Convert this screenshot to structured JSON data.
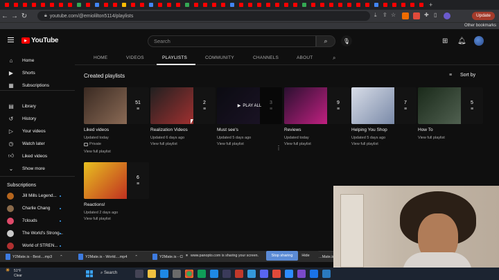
{
  "browser": {
    "url": "youtube.com/@emiolilton5114/playlists",
    "update_label": "Update",
    "other_bookmarks": "Other bookmarks"
  },
  "tab_colors": [
    "#ff0000",
    "#ff0000",
    "#ff0000",
    "#ff0000",
    "#ff0000",
    "#ff0000",
    "#ff0000",
    "#ff0000",
    "#34a853",
    "#ff0000",
    "#4285f4",
    "#ff0000",
    "#ff0000",
    "#fbbc04",
    "#ff0000",
    "#ff0000",
    "#4285f4",
    "#ff0000",
    "#ff0000",
    "#ff0000",
    "#34a853",
    "#ff0000",
    "#ff0000",
    "#ff0000",
    "#ff0000",
    "#4285f4",
    "#ff0000",
    "#ff0000",
    "#ff0000",
    "#ff0000",
    "#ff0000",
    "#ff0000",
    "#ff0000",
    "#34a853",
    "#ff0000",
    "#ff0000",
    "#ff0000",
    "#ff0000",
    "#ff0000",
    "#ff0000",
    "#ff0000",
    "#4285f4",
    "#ff0000",
    "#ff0000",
    "#ff0000",
    "#ff0000",
    "#ff0000"
  ],
  "header": {
    "logo_text": "YouTube",
    "search_placeholder": "Search"
  },
  "sidebar": {
    "items": [
      {
        "label": "Home",
        "icon": "home-icon"
      },
      {
        "label": "Shorts",
        "icon": "shorts-icon"
      },
      {
        "label": "Subscriptions",
        "icon": "subscriptions-icon"
      },
      {
        "label": "Library",
        "icon": "library-icon"
      },
      {
        "label": "History",
        "icon": "history-icon"
      },
      {
        "label": "Your videos",
        "icon": "your-videos-icon"
      },
      {
        "label": "Watch later",
        "icon": "watch-later-icon"
      },
      {
        "label": "Liked videos",
        "icon": "liked-videos-icon"
      },
      {
        "label": "Show more",
        "icon": "chevron-down-icon"
      }
    ],
    "subscriptions_heading": "Subscriptions",
    "subscriptions": [
      {
        "label": "Jill Mills Legend...",
        "color": "#b5651d"
      },
      {
        "label": "Charlie Chang",
        "color": "#8a6a4a"
      },
      {
        "label": "7clouds",
        "color": "#e04a6a"
      },
      {
        "label": "The World's Strong...",
        "color": "#c9c9c9"
      },
      {
        "label": "World of STREN...",
        "color": "#b03030"
      }
    ]
  },
  "channel_tabs": [
    {
      "label": "HOME"
    },
    {
      "label": "VIDEOS"
    },
    {
      "label": "PLAYLISTS"
    },
    {
      "label": "COMMUNITY"
    },
    {
      "label": "CHANNELS"
    },
    {
      "label": "ABOUT"
    }
  ],
  "section": {
    "heading": "Created playlists",
    "sort_label": "Sort by"
  },
  "playlists": [
    {
      "title": "Liked videos",
      "count": "51",
      "updated": "Updated today",
      "privacy": "Private",
      "link": "View full playlist",
      "c1": "#3a2a22",
      "c2": "#8a6a55"
    },
    {
      "title": "Realization Videos",
      "count": "2",
      "updated": "Updated 6 days ago",
      "link": "View full playlist",
      "c1": "#202020",
      "c2": "#a03030"
    },
    {
      "title": "Must see's",
      "count": "3",
      "updated": "Updated 5 days ago",
      "link": "View full playlist",
      "play_all": "PLAY ALL",
      "c1": "#1a1a28",
      "c2": "#3a2a50"
    },
    {
      "title": "Reviews",
      "count": "9",
      "updated": "Updated today",
      "link": "View full playlist",
      "c1": "#2a1030",
      "c2": "#c02080"
    },
    {
      "title": "Helping You Shop",
      "count": "7",
      "updated": "Updated 5 days ago",
      "link": "View full playlist",
      "c1": "#d8dde8",
      "c2": "#7a8aa8"
    },
    {
      "title": "How To",
      "count": "5",
      "updated": "",
      "link": "View full playlist",
      "c1": "#1a2a1a",
      "c2": "#506050"
    },
    {
      "title": "Reactions!",
      "count": "6",
      "updated": "Updated 2 days ago",
      "link": "View full playlist",
      "c1": "#e8c020",
      "c2": "#c03020"
    }
  ],
  "screen_share": {
    "message": "www.panopto.com is sharing your screen.",
    "stop_label": "Stop sharing",
    "hide_label": "Hide"
  },
  "downloads": [
    {
      "label": "Y2Mate.is - Best....mp3"
    },
    {
      "label": "Y2Mate.is - World....mp4"
    },
    {
      "label": "Y2Mate.is - Cl..."
    },
    {
      "label": "...Mate.is - Th..."
    }
  ],
  "taskbar": {
    "temperature": "51°F",
    "condition": "Clear",
    "search_label": "Search"
  }
}
